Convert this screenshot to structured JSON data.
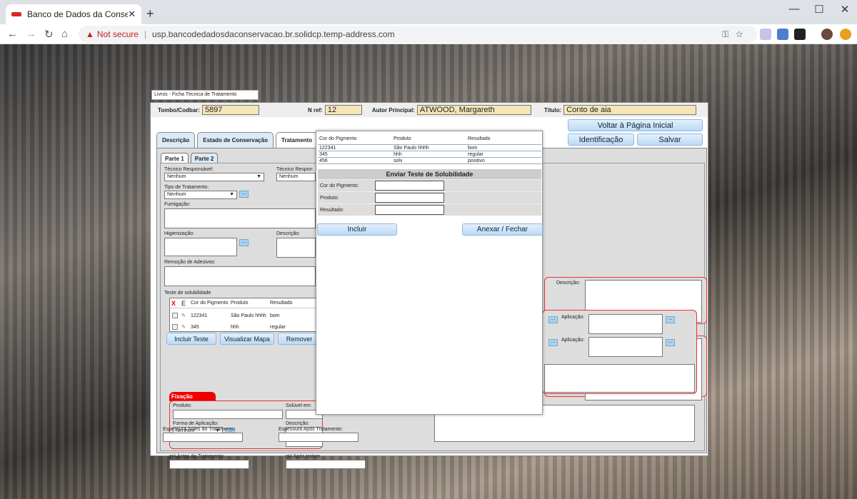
{
  "browser": {
    "tab_title": "Banco de Dados da Conservação",
    "url": "usp.bancodedadosdaconservacao.br.solidcp.temp-address.com",
    "not_secure": "Not secure"
  },
  "page_label": "Livros - Ficha Técnica de Tratamento",
  "header": {
    "tombo_label": "Tombo/Codbar:",
    "tombo": "5897",
    "nref_label": "N ref:",
    "nref": "12",
    "autor_label": "Autor Principal:",
    "autor": "ATWOOD, Margareth",
    "titulo_label": "Título:",
    "titulo": "Conto de aia"
  },
  "buttons": {
    "voltar": "Voltar à Página Inicial",
    "identificacao": "Identificação",
    "salvar": "Salvar",
    "incluir_teste": "Incluir Teste",
    "visualizar_mapa": "Visualizar Mapa",
    "remover": "Remover",
    "incluir": "Incluir",
    "anexar": "Anexar / Fechar",
    "dots": "..."
  },
  "tabs": [
    "Descrição",
    "Estado de Conservação",
    "Tratamento"
  ],
  "subtabs": [
    "Parte 1",
    "Parte 2"
  ],
  "fields": {
    "tecnico": "Técnico Responsável:",
    "tecnico2": "Técnico Respon",
    "nenhum": "Nenhum",
    "tipo": "Tipo de Tratamento:",
    "fumigacao": "Fumigação:",
    "higienizacao": "Higienização:",
    "descricao": "Descrição:",
    "remocao": "Remoção de Adesivos:",
    "teste": "Teste de solubilidade",
    "fixacao": "Fixação",
    "produto": "Produto:",
    "soluvel": "Solúvel em:",
    "forma": "Forma de Aplicação:",
    "ph_antes": "pH Antes do Tratamento:",
    "ph_apos": "pH Após tratam",
    "esp_antes": "Espessura Antes do Tratamento:",
    "esp_apos": "Espessura Após Tratamento:",
    "aplicacao": "Aplicação:"
  },
  "sol_table": {
    "cols": [
      "X",
      "E",
      "Cor do Pigmento",
      "Produto",
      "Resultado"
    ],
    "rows": [
      [
        "122341",
        "São Paulo hhhh",
        "bom"
      ],
      [
        "345",
        "hhh",
        "regular"
      ]
    ]
  },
  "modal": {
    "cols": [
      "Cor do Pigmento",
      "Produto",
      "Resultado"
    ],
    "rows": [
      [
        "122341",
        "São Paulo hhhh",
        "bom"
      ],
      [
        "345",
        "hhh",
        "regular"
      ],
      [
        "456",
        "solv",
        "positivo"
      ]
    ],
    "form_title": "Enviar Teste de Solubilidade",
    "labels": [
      "Cor do Pigmento:",
      "Produto:",
      "Resultado:"
    ]
  }
}
